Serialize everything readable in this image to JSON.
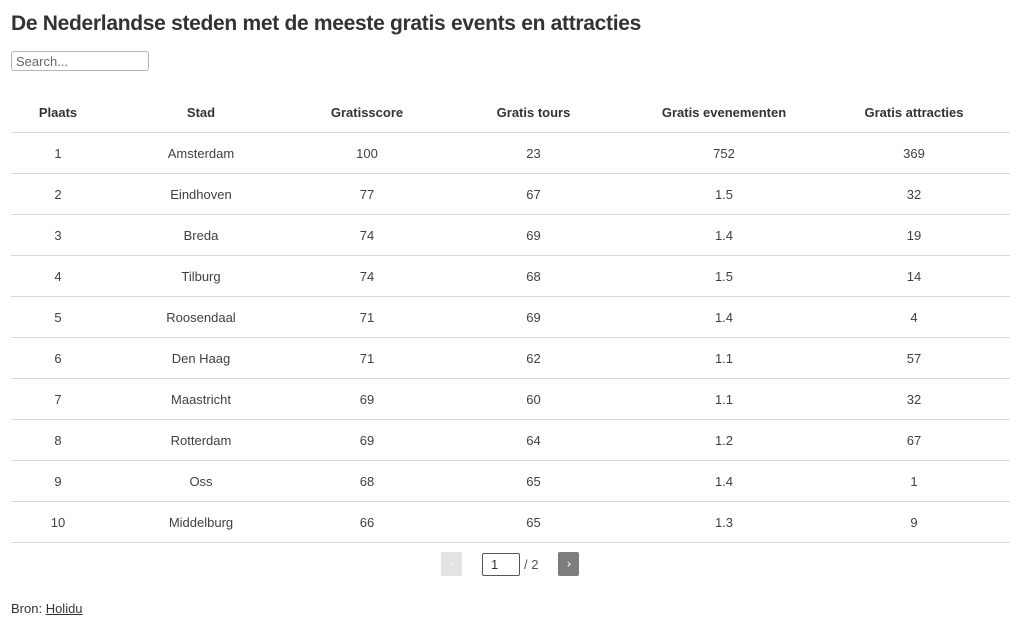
{
  "title": "De Nederlandse steden met de meeste gratis events en attracties",
  "search": {
    "placeholder": "Search...",
    "value": ""
  },
  "table": {
    "columns": [
      "Plaats",
      "Stad",
      "Gratisscore",
      "Gratis tours",
      "Gratis evenementen",
      "Gratis attracties"
    ],
    "rows": [
      [
        "1",
        "Amsterdam",
        "100",
        "23",
        "752",
        "369"
      ],
      [
        "2",
        "Eindhoven",
        "77",
        "67",
        "1.5",
        "32"
      ],
      [
        "3",
        "Breda",
        "74",
        "69",
        "1.4",
        "19"
      ],
      [
        "4",
        "Tilburg",
        "74",
        "68",
        "1.5",
        "14"
      ],
      [
        "5",
        "Roosendaal",
        "71",
        "69",
        "1.4",
        "4"
      ],
      [
        "6",
        "Den Haag",
        "71",
        "62",
        "1.1",
        "57"
      ],
      [
        "7",
        "Maastricht",
        "69",
        "60",
        "1.1",
        "32"
      ],
      [
        "8",
        "Rotterdam",
        "69",
        "64",
        "1.2",
        "67"
      ],
      [
        "9",
        "Oss",
        "68",
        "65",
        "1.4",
        "1"
      ],
      [
        "10",
        "Middelburg",
        "66",
        "65",
        "1.3",
        "9"
      ]
    ]
  },
  "pagination": {
    "prev_label": "‹",
    "next_label": "›",
    "current_page": "1",
    "total_label": "/ 2"
  },
  "footer": {
    "prefix": "Bron: ",
    "link_label": "Holidu"
  },
  "colors": {
    "text": "#333333",
    "row_divider": "#d9d9d9",
    "next_button": "#7d7d7d",
    "prev_button_disabled": "#e3e3e3"
  }
}
